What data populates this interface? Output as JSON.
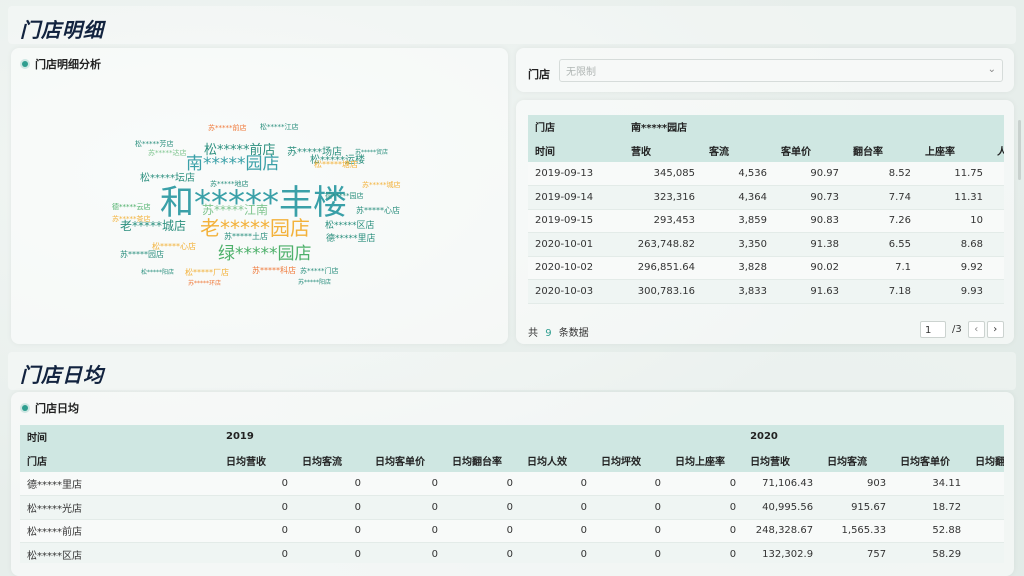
{
  "section1": {
    "title": "门店明细"
  },
  "cloud_panel": {
    "title": "门店明细分析"
  },
  "word_cloud": [
    {
      "t": "和*****丰楼",
      "c": "#3aa0a8",
      "s": 34
    },
    {
      "t": "老*****园店",
      "c": "#f3b23b",
      "s": 20
    },
    {
      "t": "绿*****园店",
      "c": "#4db06a",
      "s": 17
    },
    {
      "t": "南*****园店",
      "c": "#3aa0a8",
      "s": 17
    },
    {
      "t": "松*****前店",
      "c": "#2b8f7e",
      "s": 13
    },
    {
      "t": "老*****城店",
      "c": "#2b8f7e",
      "s": 12
    },
    {
      "t": "苏*****江南",
      "c": "#7fc58f",
      "s": 12
    },
    {
      "t": "松*****运楼",
      "c": "#2b8f7e",
      "s": 10
    },
    {
      "t": "松*****坛店",
      "c": "#2b8f7e",
      "s": 10
    },
    {
      "t": "苏*****场店",
      "c": "#2b8f7e",
      "s": 10
    },
    {
      "t": "德*****里店",
      "c": "#2b8f7e",
      "s": 9
    },
    {
      "t": "松*****区店",
      "c": "#2b8f7e",
      "s": 9
    },
    {
      "t": "苏*****土店",
      "c": "#2b8f7e",
      "s": 8
    },
    {
      "t": "松*****心店",
      "c": "#f3b23b",
      "s": 8
    },
    {
      "t": "苏*****科店",
      "c": "#f07a3b",
      "s": 8
    },
    {
      "t": "松*****厂店",
      "c": "#f3b23b",
      "s": 8
    },
    {
      "t": "苏*****心店",
      "c": "#2b8f7e",
      "s": 8
    },
    {
      "t": "苏*****门店",
      "c": "#2b8f7e",
      "s": 7
    },
    {
      "t": "松*****塘店",
      "c": "#f3b23b",
      "s": 8
    },
    {
      "t": "苏*****园店",
      "c": "#2b8f7e",
      "s": 8
    },
    {
      "t": "苏*****地店",
      "c": "#2b8f7e",
      "s": 7
    },
    {
      "t": "苏*****城店",
      "c": "#f3b23b",
      "s": 7
    },
    {
      "t": "德*****园店",
      "c": "#2b8f7e",
      "s": 7
    },
    {
      "t": "苏*****前店",
      "c": "#f07a3b",
      "s": 7
    },
    {
      "t": "松*****江店",
      "c": "#2b8f7e",
      "s": 7
    },
    {
      "t": "苏*****达店",
      "c": "#7fc58f",
      "s": 7
    },
    {
      "t": "松*****芳店",
      "c": "#2b8f7e",
      "s": 7
    },
    {
      "t": "德*****云店",
      "c": "#4db06a",
      "s": 7
    },
    {
      "t": "苏*****茶店",
      "c": "#f3b23b",
      "s": 7
    },
    {
      "t": "松*****阳店",
      "c": "#2b8f7e",
      "s": 6
    },
    {
      "t": "苏*****环店",
      "c": "#f07a3b",
      "s": 6
    },
    {
      "t": "苏*****阳店",
      "c": "#2b8f7e",
      "s": 6
    },
    {
      "t": "苏*****贸店",
      "c": "#2b8f7e",
      "s": 6
    }
  ],
  "filter": {
    "label": "门店",
    "placeholder": "无限制"
  },
  "detail_table": {
    "store_label": "门店",
    "store_value": "南*****园店",
    "columns": [
      "时间",
      "营收",
      "客流",
      "客单价",
      "翻台率",
      "上座率"
    ],
    "rows": [
      [
        "2019-09-13",
        "345,085",
        "4,536",
        "90.97",
        "8.52",
        "11.75"
      ],
      [
        "2019-09-14",
        "323,316",
        "4,364",
        "90.73",
        "7.74",
        "11.31"
      ],
      [
        "2019-09-15",
        "293,453",
        "3,859",
        "90.83",
        "7.26",
        "10"
      ],
      [
        "2020-10-01",
        "263,748.82",
        "3,350",
        "91.38",
        "6.55",
        "8.68"
      ],
      [
        "2020-10-02",
        "296,851.64",
        "3,828",
        "90.02",
        "7.1",
        "9.92"
      ],
      [
        "2020-10-03",
        "300,783.16",
        "3,833",
        "91.63",
        "7.18",
        "9.93"
      ]
    ]
  },
  "pager": {
    "total_prefix": "共",
    "total_count": "9",
    "total_suffix": "条数据",
    "page": "1",
    "page_total": "/3"
  },
  "section2": {
    "title": "门店日均"
  },
  "daily_panel": {
    "title": "门店日均"
  },
  "daily_table": {
    "head1": [
      "时间",
      "2019",
      "2020"
    ],
    "head2": [
      "门店",
      "日均营收",
      "日均客流",
      "日均客单价",
      "日均翻台率",
      "日均人效",
      "日均坪效",
      "日均上座率",
      "日均营收",
      "日均客流",
      "日均客单价",
      "日均翻"
    ],
    "rows": [
      [
        "德*****里店",
        "0",
        "0",
        "0",
        "0",
        "0",
        "0",
        "0",
        "71,106.43",
        "903",
        "34.11"
      ],
      [
        "松*****光店",
        "0",
        "0",
        "0",
        "0",
        "0",
        "0",
        "0",
        "40,995.56",
        "915.67",
        "18.72"
      ],
      [
        "松*****前店",
        "0",
        "0",
        "0",
        "0",
        "0",
        "0",
        "0",
        "248,328.67",
        "1,565.33",
        "52.88"
      ],
      [
        "松*****区店",
        "0",
        "0",
        "0",
        "0",
        "0",
        "0",
        "0",
        "132,302.9",
        "757",
        "58.29"
      ]
    ]
  }
}
